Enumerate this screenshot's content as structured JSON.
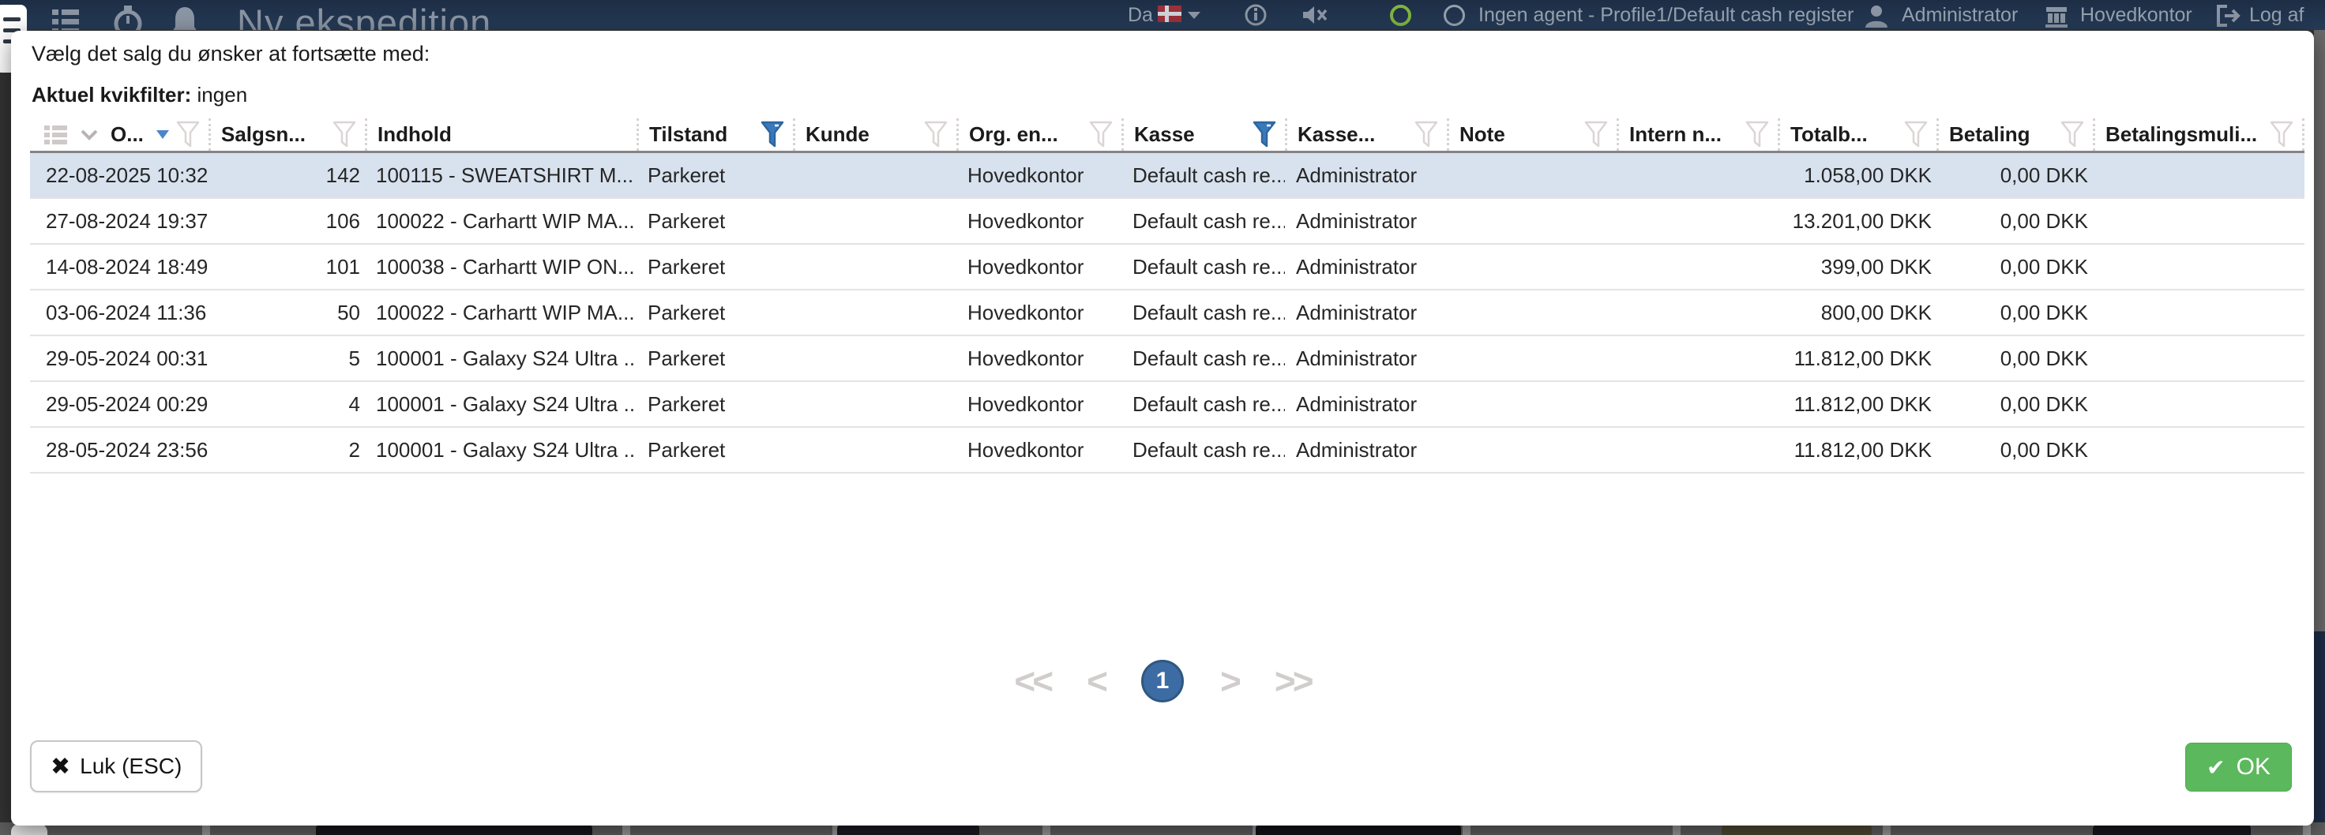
{
  "topbar": {
    "title": "Ny ekspedition",
    "language": "Da",
    "agent_status": "Ingen agent - Profile1/Default cash register",
    "user": "Administrator",
    "org_unit": "Hovedkontor",
    "logout_label": "Log af"
  },
  "dialog": {
    "prompt": "Vælg det salg du ønsker at fortsætte med:",
    "quickfilter_label": "Aktuel kvikfilter:",
    "quickfilter_value": "ingen",
    "close_label": "Luk (ESC)",
    "ok_label": "OK"
  },
  "pagination": {
    "first": "<<",
    "prev": "<",
    "current_page": "1",
    "next": ">",
    "last": ">>"
  },
  "table": {
    "columns": [
      {
        "label": "O...",
        "filter": "inactive",
        "sorted": "desc"
      },
      {
        "label": "Salgsn...",
        "filter": "inactive"
      },
      {
        "label": "Indhold",
        "filter": "none"
      },
      {
        "label": "Tilstand",
        "filter": "active"
      },
      {
        "label": "Kunde",
        "filter": "inactive"
      },
      {
        "label": "Org. en...",
        "filter": "inactive"
      },
      {
        "label": "Kasse",
        "filter": "active"
      },
      {
        "label": "Kasse...",
        "filter": "inactive"
      },
      {
        "label": "Note",
        "filter": "inactive"
      },
      {
        "label": "Intern n...",
        "filter": "inactive"
      },
      {
        "label": "Totalb...",
        "filter": "inactive"
      },
      {
        "label": "Betaling",
        "filter": "inactive"
      },
      {
        "label": "Betalingsmuli...",
        "filter": "inactive"
      }
    ],
    "rows": [
      {
        "selected": true,
        "date": "22-08-2025 10:32",
        "no": "142",
        "content": "100115 - SWEATSHIRT M...",
        "state": "Parkeret",
        "customer": "",
        "org": "Hovedkontor",
        "register": "Default cash re...",
        "cashier": "Administrator",
        "note": "",
        "intern": "",
        "total": "1.058,00 DKK",
        "payment": "0,00 DKK",
        "paymethod": ""
      },
      {
        "selected": false,
        "date": "27-08-2024 19:37",
        "no": "106",
        "content": "100022 - Carhartt WIP MA...",
        "state": "Parkeret",
        "customer": "",
        "org": "Hovedkontor",
        "register": "Default cash re...",
        "cashier": "Administrator",
        "note": "",
        "intern": "",
        "total": "13.201,00 DKK",
        "payment": "0,00 DKK",
        "paymethod": ""
      },
      {
        "selected": false,
        "date": "14-08-2024 18:49",
        "no": "101",
        "content": "100038 - Carhartt WIP ON...",
        "state": "Parkeret",
        "customer": "",
        "org": "Hovedkontor",
        "register": "Default cash re...",
        "cashier": "Administrator",
        "note": "",
        "intern": "",
        "total": "399,00 DKK",
        "payment": "0,00 DKK",
        "paymethod": ""
      },
      {
        "selected": false,
        "date": "03-06-2024 11:36",
        "no": "50",
        "content": "100022 - Carhartt WIP MA...",
        "state": "Parkeret",
        "customer": "",
        "org": "Hovedkontor",
        "register": "Default cash re...",
        "cashier": "Administrator",
        "note": "",
        "intern": "",
        "total": "800,00 DKK",
        "payment": "0,00 DKK",
        "paymethod": ""
      },
      {
        "selected": false,
        "date": "29-05-2024 00:31",
        "no": "5",
        "content": "100001 - Galaxy S24 Ultra ...",
        "state": "Parkeret",
        "customer": "",
        "org": "Hovedkontor",
        "register": "Default cash re...",
        "cashier": "Administrator",
        "note": "",
        "intern": "",
        "total": "11.812,00 DKK",
        "payment": "0,00 DKK",
        "paymethod": ""
      },
      {
        "selected": false,
        "date": "29-05-2024 00:29",
        "no": "4",
        "content": "100001 - Galaxy S24 Ultra ...",
        "state": "Parkeret",
        "customer": "",
        "org": "Hovedkontor",
        "register": "Default cash re...",
        "cashier": "Administrator",
        "note": "",
        "intern": "",
        "total": "11.812,00 DKK",
        "payment": "0,00 DKK",
        "paymethod": ""
      },
      {
        "selected": false,
        "date": "28-05-2024 23:56",
        "no": "2",
        "content": "100001 - Galaxy S24 Ultra ...",
        "state": "Parkeret",
        "customer": "",
        "org": "Hovedkontor",
        "register": "Default cash re...",
        "cashier": "Administrator",
        "note": "",
        "intern": "",
        "total": "11.812,00 DKK",
        "payment": "0,00 DKK",
        "paymethod": ""
      }
    ]
  },
  "colors": {
    "topbar_navy": "#223349",
    "filter_active_blue": "#3a79ba",
    "selected_row_blue": "#d8e2ee",
    "ok_green": "#5cb85c",
    "page_circle_blue": "#3d6ca4"
  }
}
